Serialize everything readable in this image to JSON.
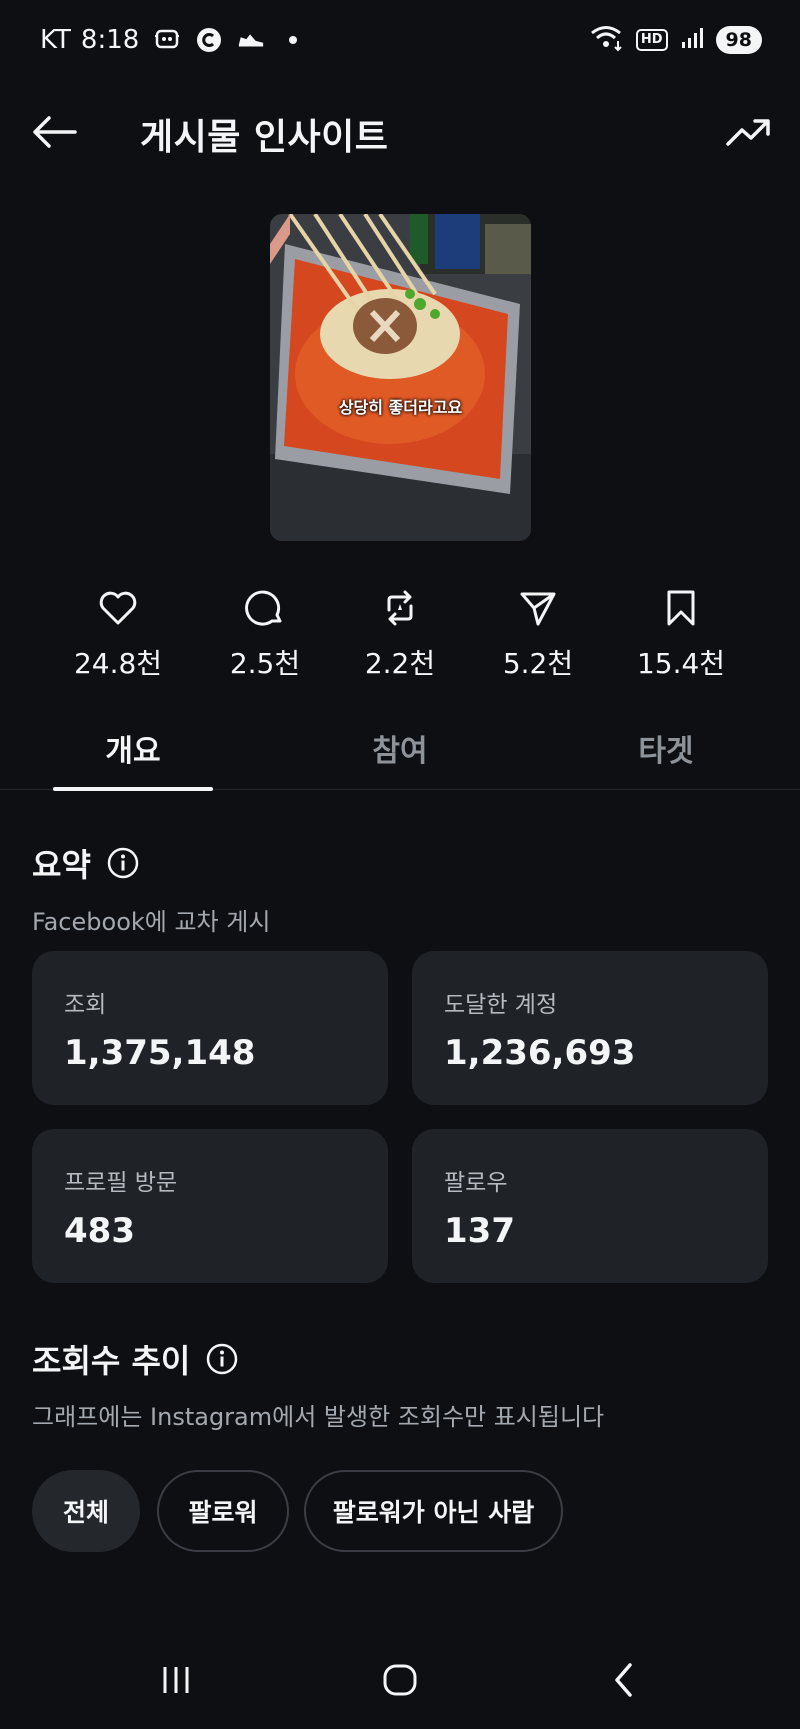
{
  "status_bar": {
    "carrier": "KT",
    "time": "8:18",
    "battery": "98",
    "hd_label": "HD"
  },
  "header": {
    "title": "게시물 인사이트"
  },
  "post": {
    "thumbnail_caption": "상당히 좋더라고요"
  },
  "stats": [
    {
      "icon": "heart-icon",
      "value": "24.8천"
    },
    {
      "icon": "comment-icon",
      "value": "2.5천"
    },
    {
      "icon": "repost-icon",
      "value": "2.2천"
    },
    {
      "icon": "share-icon",
      "value": "5.2천"
    },
    {
      "icon": "bookmark-icon",
      "value": "15.4천"
    }
  ],
  "tabs": [
    {
      "label": "개요",
      "active": true
    },
    {
      "label": "참여",
      "active": false
    },
    {
      "label": "타겟",
      "active": false
    }
  ],
  "summary": {
    "title": "요약",
    "subtitle": "Facebook에 교차 게시",
    "cards": [
      {
        "label": "조회",
        "value": "1,375,148"
      },
      {
        "label": "도달한 계정",
        "value": "1,236,693"
      },
      {
        "label": "프로필 방문",
        "value": "483"
      },
      {
        "label": "팔로우",
        "value": "137"
      }
    ]
  },
  "views_trend": {
    "title": "조회수 추이",
    "subtitle": "그래프에는 Instagram에서 발생한 조회수만 표시됩니다",
    "filters": [
      {
        "label": "전체",
        "active": true
      },
      {
        "label": "팔로워",
        "active": false
      },
      {
        "label": "팔로워가 아닌 사람",
        "active": false
      }
    ]
  },
  "colors": {
    "background": "#0d0f12",
    "card": "#1f2227",
    "text": "#f3f5f7",
    "muted": "#8e939a"
  }
}
